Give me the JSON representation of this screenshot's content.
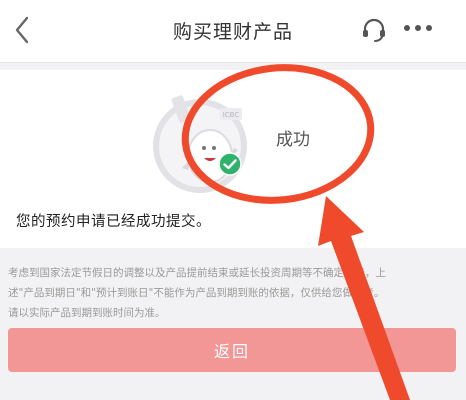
{
  "header": {
    "title": "购买理财产品",
    "back_icon": "chevron-left-icon",
    "support_icon": "headset-icon",
    "more_icon": "more-dots-icon"
  },
  "result": {
    "status_text": "成功",
    "message": "您的预约申请已经成功提交。",
    "illustration_badge": "ICBC",
    "check_icon": "check-circle-icon"
  },
  "notice": {
    "line1": "考虑到国家法定节假日的调整以及产品提前结束或延长投资周期等不确定因素，上",
    "line2": "述\"产品到期日\"和\"预计到账日\"不能作为产品到期到账的依据，仅供给您做参考。",
    "line3": "请以实际产品到期到账时间为准。"
  },
  "actions": {
    "return_label": "返回"
  },
  "colors": {
    "button": "#f29696",
    "annotation": "#ef4a2c",
    "check": "#2fb36a"
  }
}
